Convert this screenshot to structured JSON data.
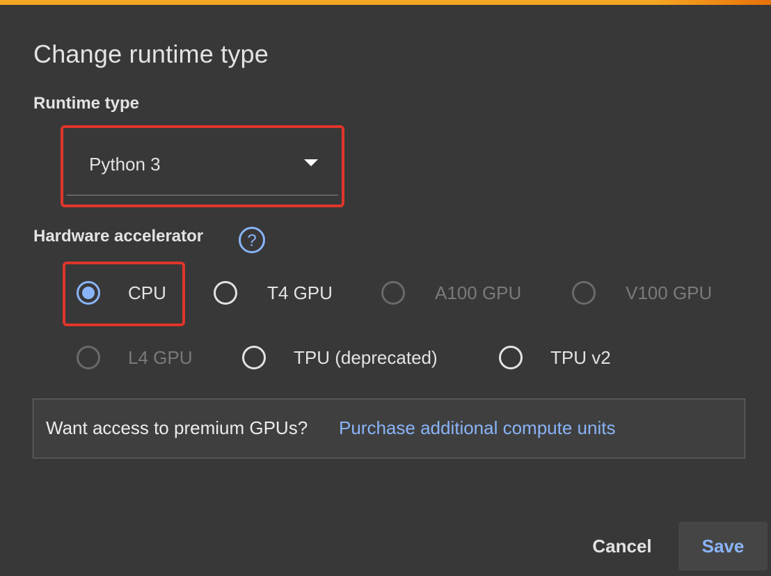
{
  "dialog": {
    "title": "Change runtime type"
  },
  "runtime": {
    "label": "Runtime type",
    "selected_value": "Python 3"
  },
  "hardware": {
    "label": "Hardware accelerator",
    "help_icon": "help-circle-icon",
    "options": [
      {
        "label": "CPU",
        "checked": true,
        "disabled": false
      },
      {
        "label": "T4 GPU",
        "checked": false,
        "disabled": false
      },
      {
        "label": "A100 GPU",
        "checked": false,
        "disabled": true
      },
      {
        "label": "V100 GPU",
        "checked": false,
        "disabled": true
      },
      {
        "label": "L4 GPU",
        "checked": false,
        "disabled": true
      },
      {
        "label": "TPU (deprecated)",
        "checked": false,
        "disabled": false
      },
      {
        "label": "TPU v2",
        "checked": false,
        "disabled": false
      }
    ]
  },
  "promo": {
    "text": "Want access to premium GPUs?",
    "link": "Purchase additional compute units"
  },
  "actions": {
    "cancel_label": "Cancel",
    "save_label": "Save"
  },
  "colors": {
    "background": "#383838",
    "accent": "#8ab4f8",
    "highlight": "#e0352b",
    "top_bar": "#f5a623"
  }
}
